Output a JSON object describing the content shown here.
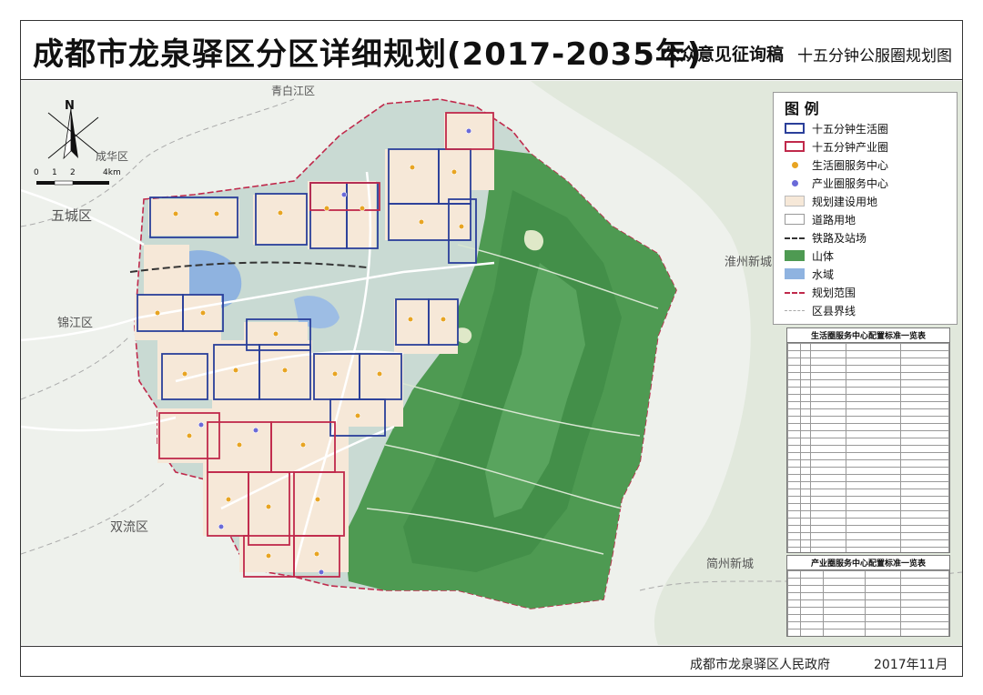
{
  "header": {
    "title": "成都市龙泉驿区分区详细规划(2017-2035年)",
    "subtitle": "公众意见征询稿",
    "map_name": "十五分钟公服圈规划图"
  },
  "footer": {
    "organization": "成都市龙泉驿区人民政府",
    "date": "2017年11月"
  },
  "compass": {
    "north_label": "N"
  },
  "scale_bar": {
    "ticks": [
      "0",
      "1",
      "2",
      "4km"
    ]
  },
  "place_labels": {
    "qingbaijiang": "青白江区",
    "chenghua": "成华区",
    "wuhou": "五城区",
    "jinjiang": "锦江区",
    "shuangliu": "双流区",
    "huaizhou": "淮州新城",
    "jianzhou": "简州新城"
  },
  "legend": {
    "title": "图 例",
    "items": [
      {
        "label": "十五分钟生活圈",
        "color": "#2a3f9a"
      },
      {
        "label": "十五分钟产业圈",
        "color": "#c0294b"
      },
      {
        "label": "生活圈服务中心",
        "color": "#e8a422"
      },
      {
        "label": "产业圈服务中心",
        "color": "#6a6ad8"
      },
      {
        "label": "规划建设用地",
        "color": "#f6e8d8"
      },
      {
        "label": "道路用地",
        "color": "#ffffff"
      },
      {
        "label": "铁路及站场",
        "color": "#333333"
      },
      {
        "label": "山体",
        "color": "#4e9a52"
      },
      {
        "label": "水域",
        "color": "#8fb3e0"
      },
      {
        "label": "规划范围",
        "color": "#c0294b"
      },
      {
        "label": "区县界线",
        "color": "#aaaaaa"
      }
    ]
  },
  "table_life": {
    "title": "生活圈服务中心配置标准一览表"
  },
  "table_industry": {
    "title": "产业圈服务中心配置标准一览表"
  },
  "colors": {
    "mountain": "#4e9a52",
    "water": "#8fb3e0",
    "life_circle": "#2a3f9a",
    "industry_circle": "#c0294b",
    "built_land": "#f6e8d8"
  }
}
